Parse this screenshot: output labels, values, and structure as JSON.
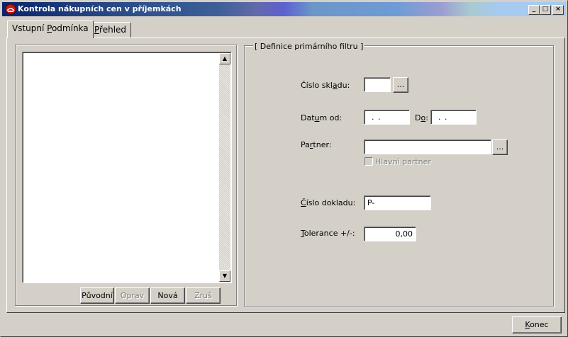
{
  "window": {
    "title": "Kontrola nákupních  cen v příjemkách",
    "minimize_glyph": "_",
    "maximize_glyph": "□",
    "close_glyph": "×"
  },
  "tabs": [
    {
      "label_pre": "Vstupní ",
      "label_accel": "P",
      "label_post": "odmínka",
      "active": true
    },
    {
      "label_pre": "",
      "label_accel": "P",
      "label_post": "řehled",
      "active": false
    }
  ],
  "filter": {
    "group_title": "[ Definice primárního filtru ]",
    "warehouse_label_pre": "Číslo skl",
    "warehouse_label_accel": "a",
    "warehouse_label_post": "du:",
    "warehouse_value": "",
    "browse_label": "...",
    "date_from_label_pre": "Dat",
    "date_from_label_accel": "u",
    "date_from_label_post": "m od:",
    "date_from_value": ". .",
    "date_to_label_pre": "D",
    "date_to_label_accel": "o",
    "date_to_label_post": ":",
    "date_to_value": ". .",
    "partner_label_pre": "Pa",
    "partner_label_accel": "r",
    "partner_label_post": "tner:",
    "partner_value": "",
    "main_partner_label": "Hlavní partner",
    "doc_label_pre": "",
    "doc_label_accel": "Č",
    "doc_label_post": "íslo dokladu:",
    "doc_value": "P-",
    "tolerance_label_pre": "",
    "tolerance_label_accel": "T",
    "tolerance_label_post": "olerance +/-:",
    "tolerance_value": "0,00"
  },
  "list_buttons": {
    "original": "Původní",
    "edit": "Oprav",
    "new": "Nová",
    "cancel": "Zruš"
  },
  "footer": {
    "close_pre": "",
    "close_accel": "K",
    "close_post": "onec"
  }
}
